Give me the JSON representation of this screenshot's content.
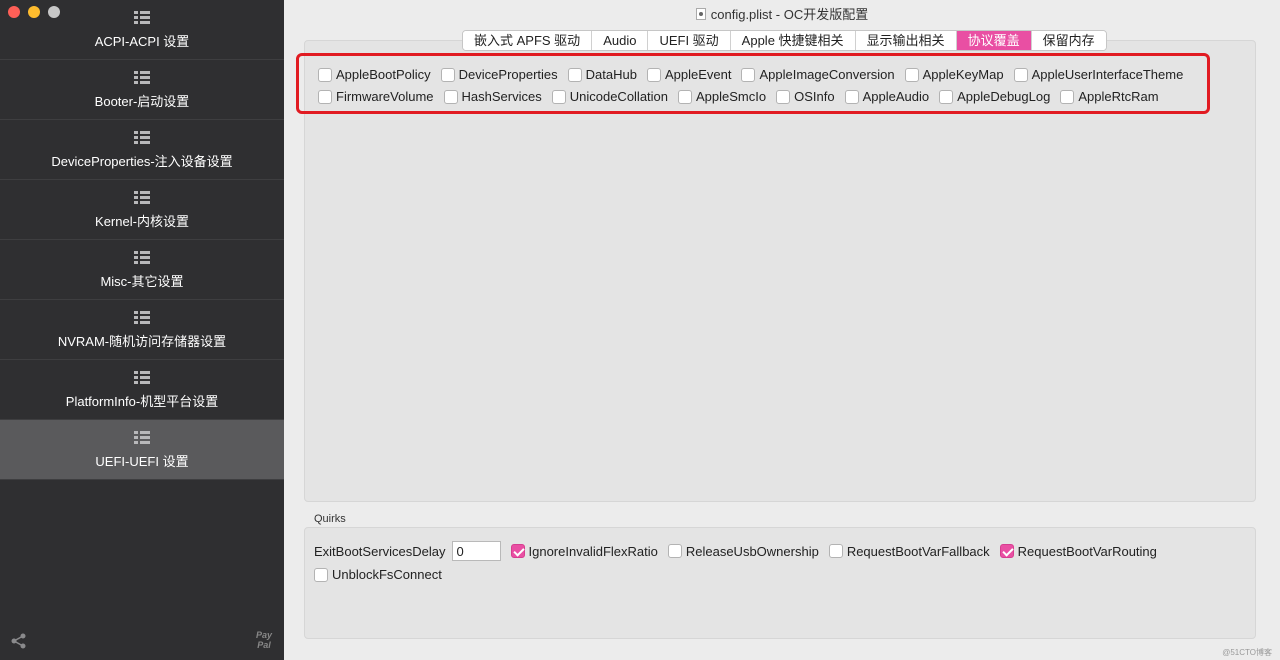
{
  "window": {
    "title": "config.plist - OC开发版配置"
  },
  "sidebar": {
    "items": [
      {
        "label": "ACPI-ACPI 设置"
      },
      {
        "label": "Booter-启动设置"
      },
      {
        "label": "DeviceProperties-注入设备设置"
      },
      {
        "label": "Kernel-内核设置"
      },
      {
        "label": "Misc-其它设置"
      },
      {
        "label": "NVRAM-随机访问存储器设置"
      },
      {
        "label": "PlatformInfo-机型平台设置"
      },
      {
        "label": "UEFI-UEFI 设置",
        "active": true
      }
    ],
    "paypal_line1": "Pay",
    "paypal_line2": "Pal"
  },
  "tabs": [
    {
      "label": "嵌入式 APFS 驱动"
    },
    {
      "label": "Audio"
    },
    {
      "label": "UEFI 驱动"
    },
    {
      "label": "Apple 快捷键相关"
    },
    {
      "label": "显示输出相关"
    },
    {
      "label": "协议覆盖",
      "active": true
    },
    {
      "label": "保留内存"
    }
  ],
  "protocols": {
    "row1": [
      {
        "label": "AppleBootPolicy",
        "checked": false
      },
      {
        "label": "DeviceProperties",
        "checked": false
      },
      {
        "label": "DataHub",
        "checked": false
      },
      {
        "label": "AppleEvent",
        "checked": false
      },
      {
        "label": "AppleImageConversion",
        "checked": false
      },
      {
        "label": "AppleKeyMap",
        "checked": false
      },
      {
        "label": "AppleUserInterfaceTheme",
        "checked": false
      }
    ],
    "row2": [
      {
        "label": "FirmwareVolume",
        "checked": false
      },
      {
        "label": "HashServices",
        "checked": false
      },
      {
        "label": "UnicodeCollation",
        "checked": false
      },
      {
        "label": "AppleSmcIo",
        "checked": false
      },
      {
        "label": "OSInfo",
        "checked": false
      },
      {
        "label": "AppleAudio",
        "checked": false
      },
      {
        "label": "AppleDebugLog",
        "checked": false
      },
      {
        "label": "AppleRtcRam",
        "checked": false
      }
    ]
  },
  "quirks": {
    "title": "Quirks",
    "exit_label": "ExitBootServicesDelay",
    "exit_value": "0",
    "row1": [
      {
        "label": "IgnoreInvalidFlexRatio",
        "checked": true
      },
      {
        "label": "ReleaseUsbOwnership",
        "checked": false
      },
      {
        "label": "RequestBootVarFallback",
        "checked": false
      },
      {
        "label": "RequestBootVarRouting",
        "checked": true
      }
    ],
    "row2": [
      {
        "label": "UnblockFsConnect",
        "checked": false
      }
    ]
  },
  "watermark": "@51CTO博客",
  "colors": {
    "accent": "#e94fa3",
    "highlight": "#e11b22",
    "sidebar": "#2f2f31"
  }
}
